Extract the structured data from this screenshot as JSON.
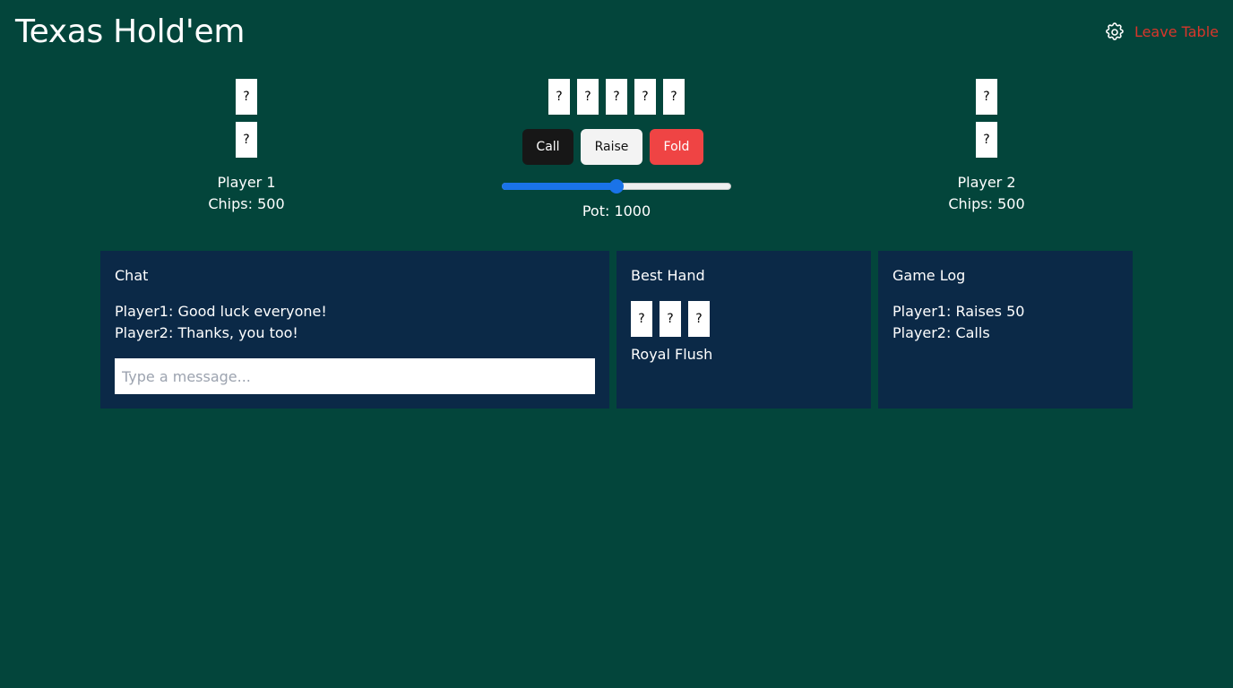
{
  "app": {
    "title": "Texas Hold'em",
    "leave_label": "Leave Table",
    "settings_icon": "gear-icon"
  },
  "players": [
    {
      "name": "Player 1",
      "chips": "Chips: 500",
      "cards": [
        "?",
        "?"
      ]
    },
    {
      "name": "Player 2",
      "chips": "Chips: 500",
      "cards": [
        "?",
        "?"
      ]
    }
  ],
  "community_cards": [
    "?",
    "?",
    "?",
    "?",
    "?"
  ],
  "actions": {
    "call_label": "Call",
    "raise_label": "Raise",
    "fold_label": "Fold"
  },
  "bet_slider": {
    "value": 50,
    "min": 0,
    "max": 100
  },
  "pot": "Pot: 1000",
  "chat": {
    "title": "Chat",
    "messages": [
      "Player1: Good luck everyone!",
      "Player2: Thanks, you too!"
    ],
    "placeholder": "Type a message..."
  },
  "best_hand": {
    "title": "Best Hand",
    "cards": [
      "?",
      "?",
      "?"
    ],
    "hand_name": "Royal Flush"
  },
  "game_log": {
    "title": "Game Log",
    "entries": [
      "Player1: Raises 50",
      "Player2: Calls"
    ]
  },
  "colors": {
    "background": "#03453b",
    "panel": "#0b2947",
    "leave": "#d9362b",
    "fold": "#ef4444",
    "accent": "#1a73e8"
  }
}
